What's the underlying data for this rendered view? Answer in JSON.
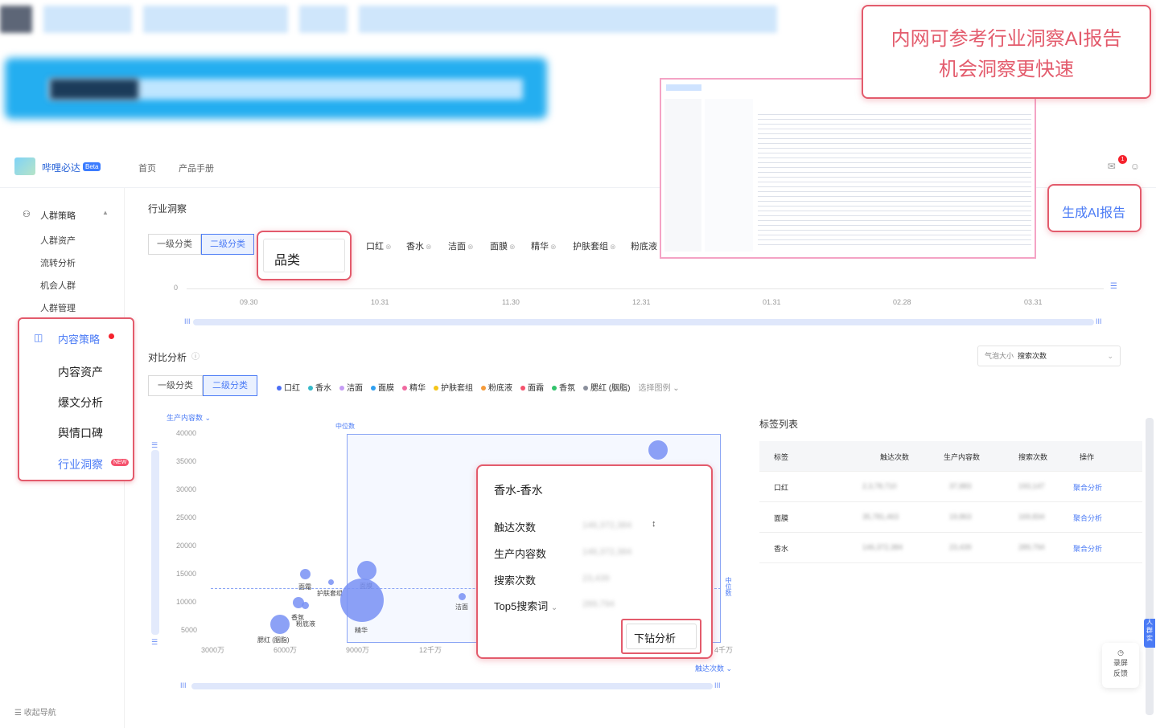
{
  "callouts": {
    "ai_report_line1": "内网可参考行业洞察AI报告",
    "ai_report_line2": "机会洞察更快速",
    "generate_btn": "生成AI报告",
    "category_label": "品类"
  },
  "topbar": {
    "logo_text": "哔哩必达",
    "beta": "Beta",
    "nav": [
      "首页",
      "产品手册"
    ],
    "notification_count": "1"
  },
  "sidebar": {
    "group_label": "人群策略",
    "group_items": [
      "人群资产",
      "流转分析",
      "机会人群",
      "人群管理"
    ],
    "content_group": "内容策略",
    "content_items": [
      "内容资产",
      "爆文分析",
      "舆情口碑",
      "行业洞察"
    ],
    "new_badge": "NEW",
    "collapse": "收起导航"
  },
  "main": {
    "title": "行业洞察",
    "level1": "一级分类",
    "level2": "二级分类",
    "tags": [
      "口红",
      "香水",
      "洁面",
      "面膜",
      "精华",
      "护肤套组",
      "粉底液"
    ],
    "date_ticks": [
      "09.30",
      "10.31",
      "11.30",
      "12.31",
      "01.31",
      "02.28",
      "03.31"
    ],
    "zero": "0"
  },
  "compare": {
    "title": "对比分析",
    "bubble_select_a": "气泡大小",
    "bubble_select_b": "搜索次数",
    "legend": [
      {
        "name": "口红",
        "color": "#4b6ef5"
      },
      {
        "name": "香水",
        "color": "#35b9c9"
      },
      {
        "name": "洁面",
        "color": "#c59cf5"
      },
      {
        "name": "面膜",
        "color": "#2f9ff0"
      },
      {
        "name": "精华",
        "color": "#f06aa0"
      },
      {
        "name": "护肤套组",
        "color": "#f5c518"
      },
      {
        "name": "粉底液",
        "color": "#f59b3a"
      },
      {
        "name": "面霜",
        "color": "#f5516c"
      },
      {
        "name": "香氛",
        "color": "#32c36c"
      },
      {
        "name": "腮红 (胭脂)",
        "color": "#8a8f9c"
      }
    ],
    "legend_more": "选择图例",
    "y_axis_label": "生产内容数",
    "x_axis_label": "触达次数",
    "median_label": "中位数",
    "y_ticks": [
      "40000",
      "35000",
      "30000",
      "25000",
      "20000",
      "15000",
      "10000",
      "5000"
    ],
    "x_ticks": [
      "3000万",
      "6000万",
      "9000万",
      "12千万"
    ],
    "x_tick_right": "4千万"
  },
  "bubbles": [
    {
      "name": "面霜"
    },
    {
      "name": "护肤套组"
    },
    {
      "name": "面膜"
    },
    {
      "name": "香氛"
    },
    {
      "name": "粉底液"
    },
    {
      "name": "腮红 (胭脂)"
    },
    {
      "name": "精华"
    },
    {
      "name": "洁面"
    }
  ],
  "tag_table": {
    "title": "标签列表",
    "headers": [
      "标签",
      "触达次数",
      "生产内容数",
      "搜索次数",
      "操作"
    ],
    "rows": [
      {
        "tag": "口红",
        "reach": "2,3,78,710",
        "produce": "37,883",
        "search": "193,147",
        "action": "聚合分析"
      },
      {
        "tag": "面膜",
        "reach": "35,781,463",
        "produce": "19,863",
        "search": "169,834",
        "action": "聚合分析"
      },
      {
        "tag": "香水",
        "reach": "146,372,384",
        "produce": "23,439",
        "search": "289,794",
        "action": "聚合分析"
      }
    ]
  },
  "popup": {
    "title": "香水-香水",
    "rows": [
      {
        "label": "触达次数",
        "value": "146,372,384"
      },
      {
        "label": "生产内容数",
        "value": "146,372,384"
      },
      {
        "label": "搜索次数",
        "value": "23,439"
      },
      {
        "label": "Top5搜索词",
        "value": "289,794"
      }
    ],
    "drill_btn": "下钻分析"
  },
  "float": {
    "feedback_line1": "录屏",
    "feedback_line2": "反馈",
    "side_tab": "人群实"
  }
}
